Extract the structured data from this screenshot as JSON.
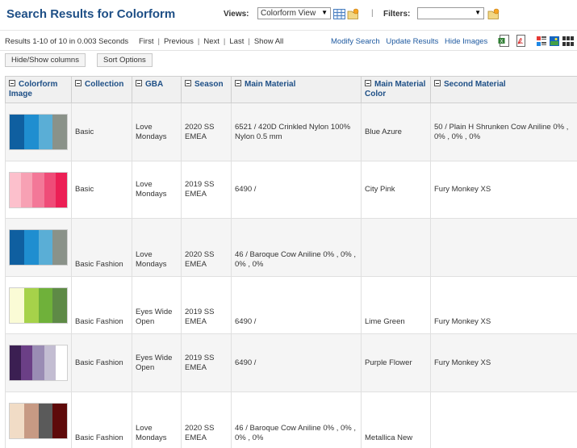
{
  "header": {
    "title": "Search Results for Colorform",
    "views_label": "Views:",
    "views_selected": "Colorform View",
    "separator": "|",
    "filters_label": "Filters:",
    "filters_selected": ""
  },
  "navbar": {
    "results_info": "Results 1-10 of 10 in 0.003 Seconds",
    "links": [
      "First",
      "Previous",
      "Next",
      "Last",
      "Show All"
    ],
    "right_links": [
      "Modify Search",
      "Update Results",
      "Hide Images"
    ]
  },
  "buttons": {
    "hide_show": "Hide/Show columns",
    "sort": "Sort Options"
  },
  "columns": [
    "Colorform Image",
    "Collection",
    "GBA",
    "Season",
    "Main Material",
    "Main Material Color",
    "Second Material"
  ],
  "rows": [
    {
      "swatches": [
        "#0f5fa0",
        "#1f8ed0",
        "#5aaed6",
        "#8a9289"
      ],
      "collection": "Basic",
      "gba": "Love Mondays",
      "season": "2020 SS EMEA",
      "main_material": "6521 / 420D Crinkled Nylon 100% Nylon 0.5 mm",
      "main_material_color": "Blue Azure",
      "second_material": "50 / Plain H Shrunken   Cow Aniline 0% , 0% , 0% , 0%"
    },
    {
      "swatches": [
        "#fcc0cc",
        "#f7a1b4",
        "#f37898",
        "#ef4c78",
        "#ec1f55"
      ],
      "collection": "Basic",
      "gba": "Love Mondays",
      "season": "2019 SS EMEA",
      "main_material": "6490 /",
      "main_material_color": "City Pink",
      "second_material": "Fury Monkey XS"
    },
    {
      "swatches": [
        "#0f5fa0",
        "#1f8ed0",
        "#5aaed6",
        "#8a9289"
      ],
      "collection": "Basic Fashion",
      "gba": "Love Mondays",
      "season": "2020 SS EMEA",
      "main_material": "46 / Baroque   Cow Aniline 0% , 0% , 0% , 0%",
      "main_material_color": "",
      "second_material": ""
    },
    {
      "swatches": [
        "#fafbd6",
        "#a6d24a",
        "#6fb13a",
        "#5e8a46"
      ],
      "collection": "Basic Fashion",
      "gba": "Eyes Wide Open",
      "season": "2019 SS EMEA",
      "main_material": "6490 /",
      "main_material_color": "Lime Green",
      "second_material": "Fury Monkey XS"
    },
    {
      "swatches": [
        "#3b1f52",
        "#6b3f86",
        "#9a8cb4",
        "#c3bdd2",
        "#ffffff"
      ],
      "collection": "Basic Fashion",
      "gba": "Eyes Wide Open",
      "season": "2019 SS EMEA",
      "main_material": "6490 /",
      "main_material_color": "Purple Flower",
      "second_material": "Fury Monkey XS"
    },
    {
      "swatches": [
        "#f1dcc6",
        "#c79a84",
        "#5a5a5a",
        "#5e0a0a"
      ],
      "collection": "Basic Fashion",
      "gba": "Love Mondays",
      "season": "2020 SS EMEA",
      "main_material": "46 / Baroque   Cow Aniline 0% , 0% , 0% , 0%",
      "main_material_color": "Metallica New",
      "second_material": ""
    }
  ],
  "icons": [
    "grid-view-icon",
    "folder-add-icon",
    "excel-export-icon",
    "pdf-export-icon",
    "view-list-icon",
    "view-thumbnail-icon",
    "view-grid-icon",
    "column-collapse-icon"
  ]
}
